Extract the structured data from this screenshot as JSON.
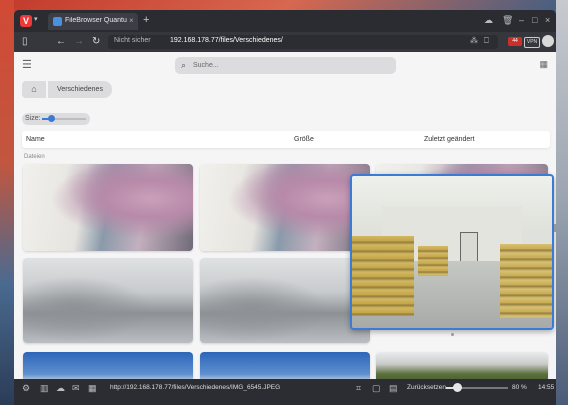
{
  "browser": {
    "tab_title": "FileBrowser Quantum - Dat",
    "tab_new": "+",
    "security_label": "Nicht sicher",
    "url": "192.168.178.77/files/Verschiedenes/",
    "badge_red": "44",
    "badge_vpn": "VPN"
  },
  "app": {
    "search_placeholder": "Suche...",
    "breadcrumb_dir": "Verschiedenes",
    "size_label": "Size:",
    "columns": {
      "name": "Name",
      "size": "Größe",
      "modified": "Zuletzt geändert"
    },
    "section_label": "Dateien"
  },
  "statusbar": {
    "link_url": "http://192.168.178.77/files/Verschiedenes/IMG_6545.JPEG",
    "reset_label": "Zurücksetzen",
    "zoom": "80 %",
    "time": "14:55",
    "zoom_fraction": 0.1
  },
  "colors": {
    "accent": "#3a7bd5",
    "browser_red": "#ef3939"
  }
}
